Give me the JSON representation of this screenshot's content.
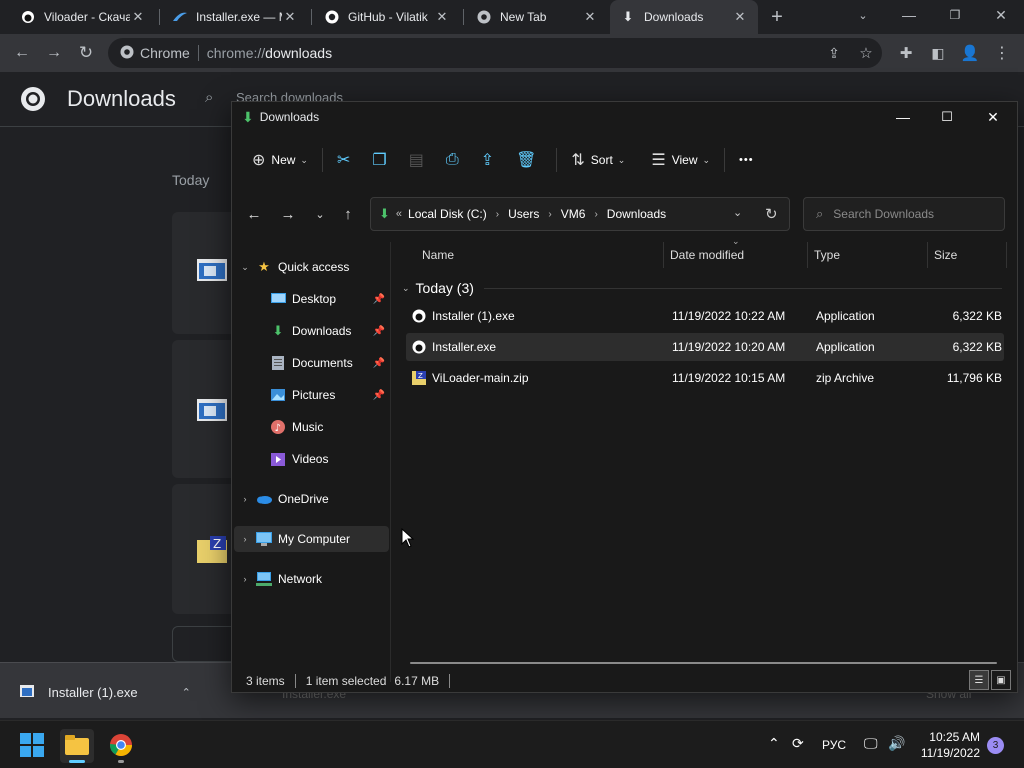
{
  "chrome": {
    "tabs": [
      {
        "title": "Viloader - Скачать",
        "icon": "viloader-icon"
      },
      {
        "title": "Installer.exe — M",
        "icon": "mega-icon"
      },
      {
        "title": "GitHub - Vilatik",
        "icon": "github-icon"
      },
      {
        "title": "New Tab",
        "icon": "chrome-icon"
      },
      {
        "title": "Downloads",
        "icon": "download-icon",
        "active": true
      }
    ],
    "new_tab_glyph": "+",
    "omnibox": {
      "chip": "Chrome",
      "scheme": "chrome://",
      "host": "downloads"
    },
    "page": {
      "title": "Downloads",
      "search_placeholder": "Search downloads",
      "today_label": "Today"
    },
    "shelf": {
      "item": "Installer (1).exe",
      "hidden_item": "Installer.exe",
      "show_all": "Show all"
    }
  },
  "explorer": {
    "title": "Downloads",
    "commands": {
      "new": "New",
      "sort": "Sort",
      "view": "View",
      "more": "•••"
    },
    "breadcrumbs": [
      "Local Disk (C:)",
      "Users",
      "VM6",
      "Downloads"
    ],
    "breadcrumb_overflow": "«",
    "search_placeholder": "Search Downloads",
    "nav": {
      "quick_access": "Quick access",
      "items": [
        "Desktop",
        "Downloads",
        "Documents",
        "Pictures",
        "Music",
        "Videos"
      ],
      "onedrive": "OneDrive",
      "my_computer": "My Computer",
      "network": "Network"
    },
    "columns": {
      "name": "Name",
      "date": "Date modified",
      "type": "Type",
      "size": "Size"
    },
    "group": "Today (3)",
    "files": [
      {
        "name": "Installer (1).exe",
        "date": "11/19/2022 10:22 AM",
        "type": "Application",
        "size": "6,322 KB"
      },
      {
        "name": "Installer.exe",
        "date": "11/19/2022 10:20 AM",
        "type": "Application",
        "size": "6,322 KB"
      },
      {
        "name": "ViLoader-main.zip",
        "date": "11/19/2022 10:15 AM",
        "type": "zip Archive",
        "size": "11,796 KB"
      }
    ],
    "status": {
      "count": "3 items",
      "selected": "1 item selected",
      "size": "6.17 MB"
    }
  },
  "taskbar": {
    "lang": "РУС",
    "time": "10:25 AM",
    "date": "11/19/2022",
    "notifications": "3"
  },
  "colors": {
    "accent": "#60cdff",
    "folder": "#f5c342"
  }
}
